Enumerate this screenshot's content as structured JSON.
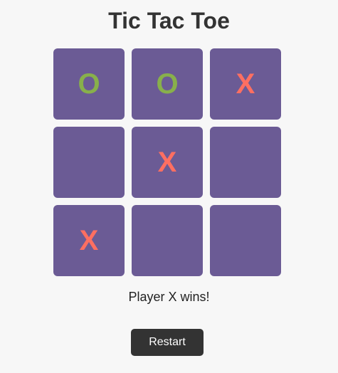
{
  "title": "Tic Tac Toe",
  "board": {
    "cells": [
      "O",
      "O",
      "X",
      "",
      "X",
      "",
      "X",
      "",
      ""
    ]
  },
  "status": "Player X wins!",
  "restart_label": "Restart",
  "colors": {
    "background": "#f7f7f7",
    "cell": "#6b5b95",
    "x_mark": "#ff6f61",
    "o_mark": "#88b04b",
    "button": "#333333"
  }
}
